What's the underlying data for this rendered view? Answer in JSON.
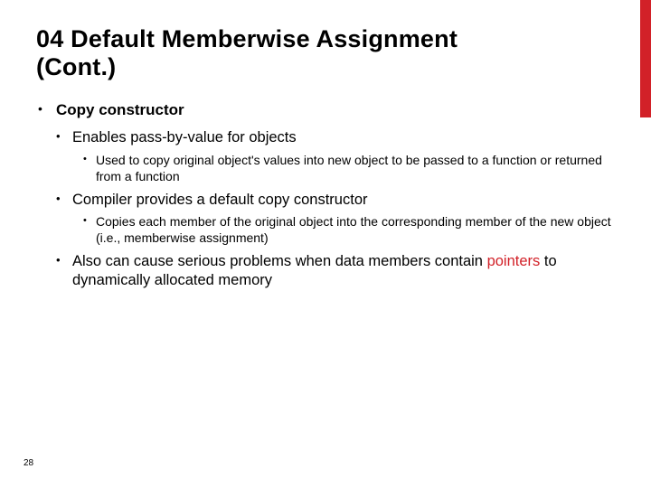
{
  "colors": {
    "accent": "#d22128"
  },
  "title_line1": "04 Default Memberwise Assignment",
  "title_line2": "(Cont.)",
  "bullets": {
    "l1_1": "Copy constructor",
    "l2_1": "Enables pass-by-value for objects",
    "l3_1": "Used to copy original object's values into new object to be passed to a function or returned from a function",
    "l2_2": "Compiler provides a default copy constructor",
    "l3_2": "Copies each member of the original object into the corresponding member of the new object (i.e., memberwise assignment)",
    "l2_3_a": "Also can cause serious problems when data members contain ",
    "l2_3_red": "pointers",
    "l2_3_b": " to dynamically allocated memory"
  },
  "page_number": "28"
}
